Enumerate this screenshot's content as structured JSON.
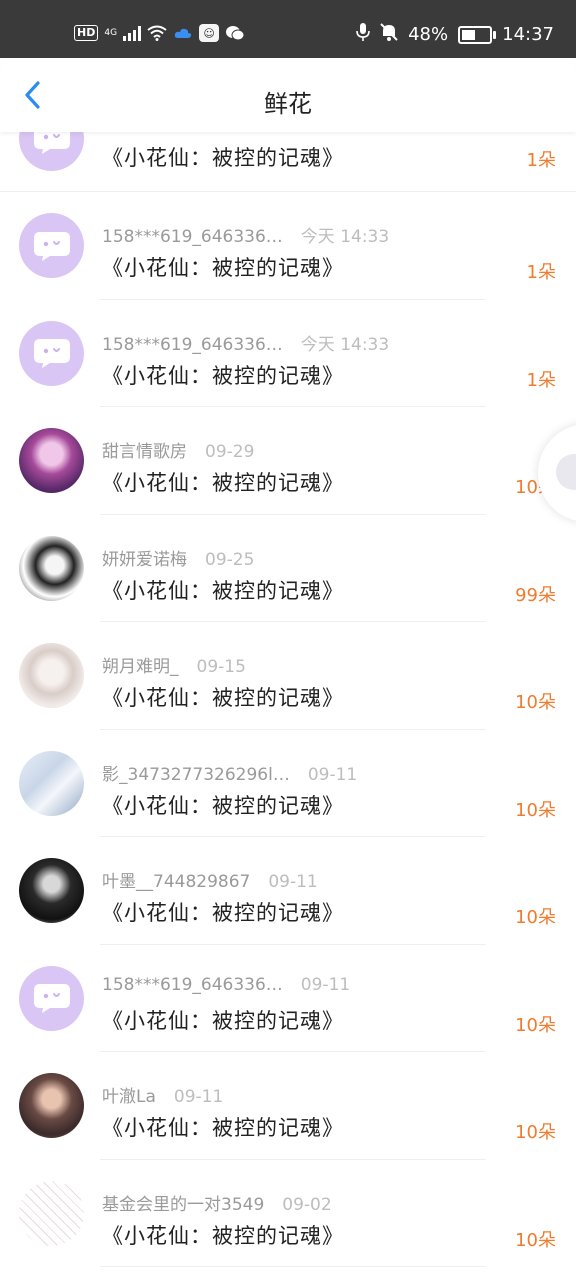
{
  "status_bar": {
    "hd": "HD",
    "network": "4G",
    "battery_pct_text": "48%",
    "battery_level": 0.48,
    "time": "14:37",
    "icons": [
      "signal-icon",
      "wifi-icon",
      "cloud-icon",
      "app-icon",
      "wechat-icon",
      "mic-icon",
      "mute-icon",
      "battery-icon"
    ]
  },
  "header": {
    "title": "鲜花",
    "back_icon": "back-chevron-icon"
  },
  "list": {
    "items": [
      {
        "user": "",
        "time": "",
        "book": "《小花仙：被控的记魂》",
        "count": "1朵",
        "avatar": "default"
      },
      {
        "user": "158***619_646336…",
        "time": "今天 14:33",
        "book": "《小花仙：被控的记魂》",
        "count": "1朵",
        "avatar": "default"
      },
      {
        "user": "158***619_646336…",
        "time": "今天 14:33",
        "book": "《小花仙：被控的记魂》",
        "count": "1朵",
        "avatar": "default"
      },
      {
        "user": "甜言情歌房",
        "time": "09-29",
        "book": "《小花仙：被控的记魂》",
        "count": "10朵",
        "avatar": "photo-purple"
      },
      {
        "user": "妍妍爱诺梅",
        "time": "09-25",
        "book": "《小花仙：被控的记魂》",
        "count": "99朵",
        "avatar": "photo-bw"
      },
      {
        "user": "朔月难明_",
        "time": "09-15",
        "book": "《小花仙：被控的记魂》",
        "count": "10朵",
        "avatar": "photo-sketch"
      },
      {
        "user": "影_3473277326296l…",
        "time": "09-11",
        "book": "《小花仙：被控的记魂》",
        "count": "10朵",
        "avatar": "photo-light"
      },
      {
        "user": "叶墨__744829867",
        "time": "09-11",
        "book": "《小花仙：被控的记魂》",
        "count": "10朵",
        "avatar": "photo-dark"
      },
      {
        "user": "158***619_646336…",
        "time": "09-11",
        "book": "《小花仙：被控的记魂》",
        "count": "10朵",
        "avatar": "default"
      },
      {
        "user": "叶澈La",
        "time": "09-11",
        "book": "《小花仙：被控的记魂》",
        "count": "10朵",
        "avatar": "photo-brown"
      },
      {
        "user": "基金会里的一对3549",
        "time": "09-02",
        "book": "《小花仙：被控的记魂》",
        "count": "10朵",
        "avatar": "photo-lineart"
      }
    ]
  },
  "colors": {
    "accent": "#2a8cf0",
    "count": "#ef7c2e",
    "avatar_default": "#d9c6f4",
    "status_bar": "#3a3a3a"
  }
}
